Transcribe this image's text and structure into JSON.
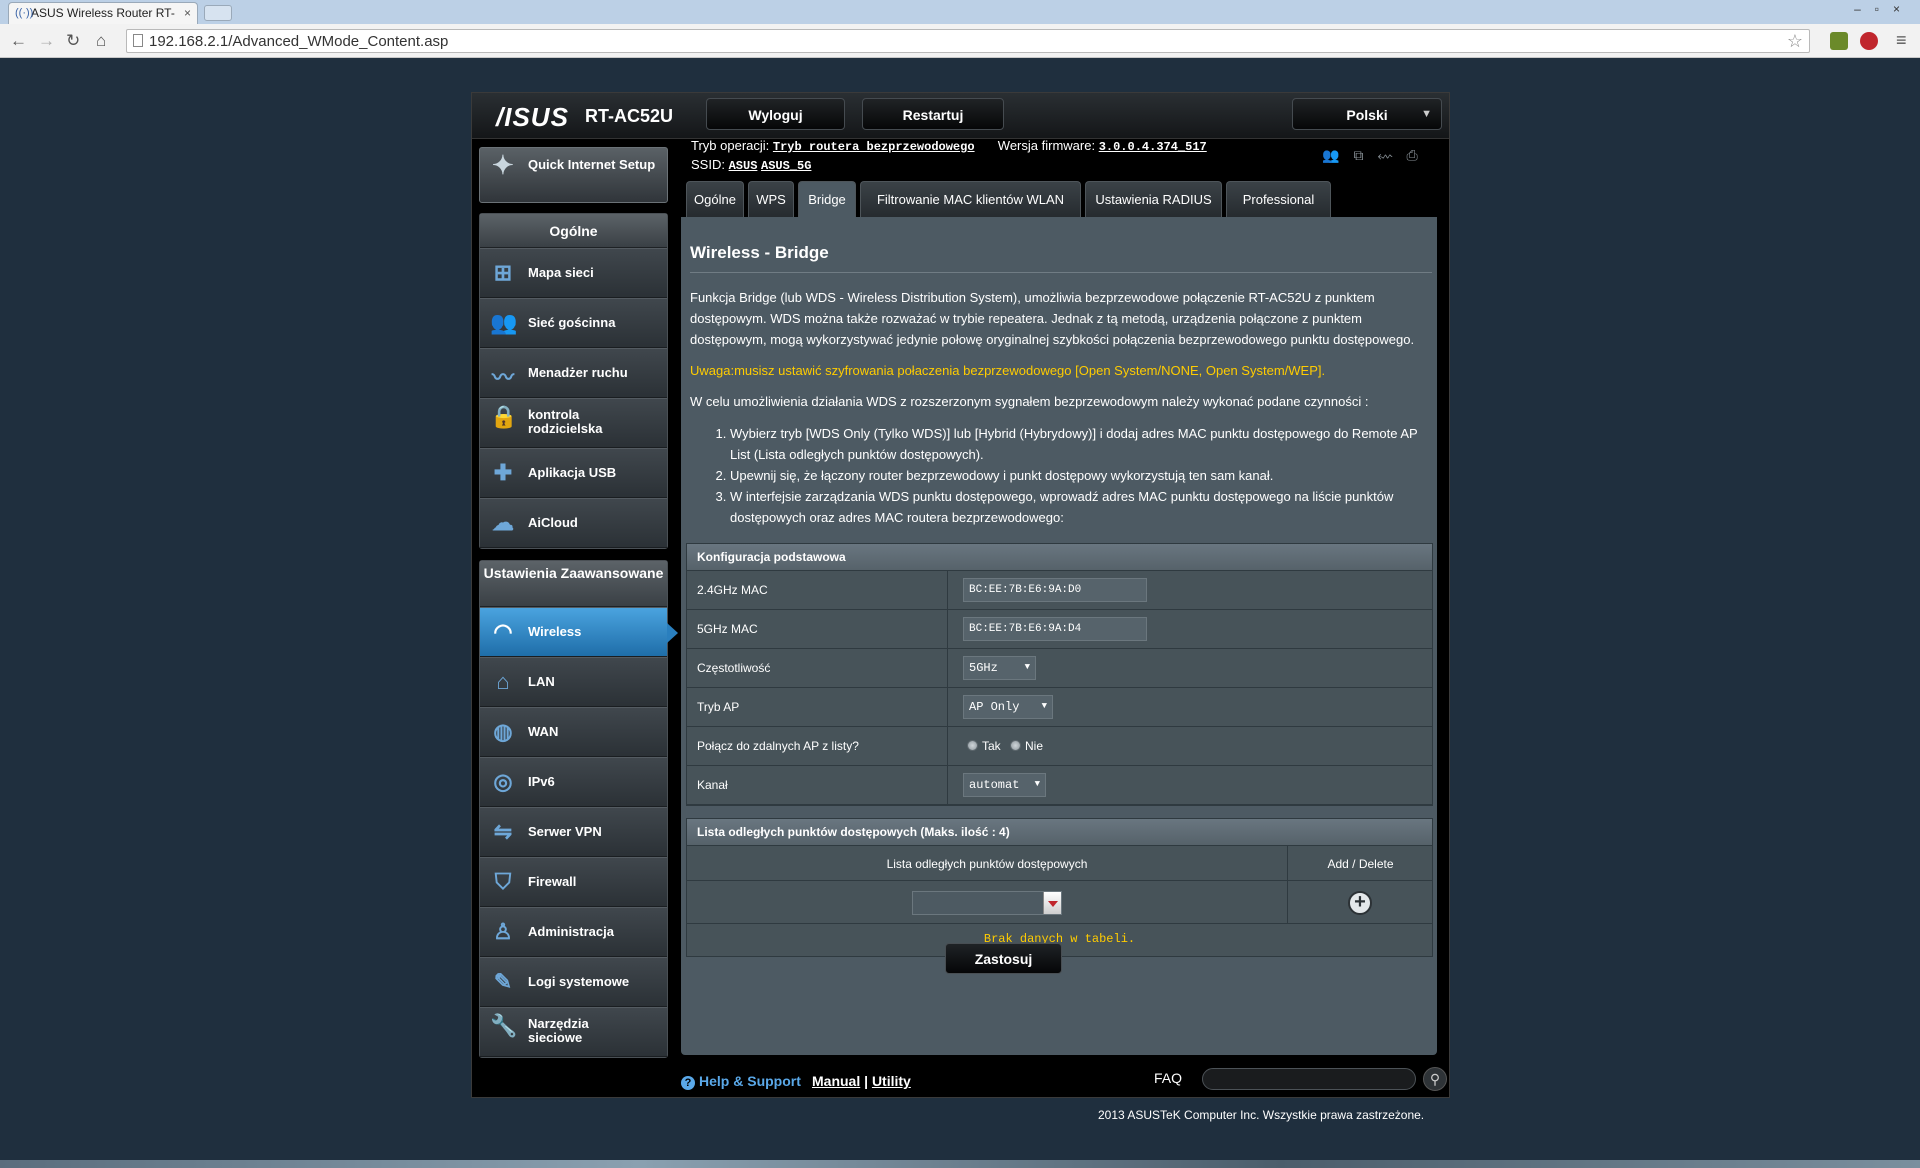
{
  "browser": {
    "tab_title": "ASUS Wireless Router RT-",
    "tab_close": "×",
    "url": "192.168.2.1/Advanced_WMode_Content.asp",
    "window_buttons": "–▫×"
  },
  "header": {
    "logo": "/ISUS",
    "model": "RT-AC52U",
    "logout_label": "Wyloguj",
    "restart_label": "Restartuj",
    "language": "Polski",
    "operation_mode_label": "Tryb operacji:",
    "operation_mode_value": "Tryb routera bezprzewodowego",
    "firmware_label": "Wersja firmware:",
    "firmware_value": "3.0.0.4.374_517",
    "ssid_label": "SSID:",
    "ssid_1": "ASUS",
    "ssid_2": "ASUS_5G"
  },
  "sidebar": {
    "qis_label": "Quick Internet Setup",
    "general_heading": "Ogólne",
    "general_items": [
      {
        "label": "Mapa sieci",
        "icon": "network-map-icon"
      },
      {
        "label": "Sieć gościnna",
        "icon": "guest-network-icon"
      },
      {
        "label": "Menadżer ruchu",
        "icon": "traffic-manager-icon"
      },
      {
        "label": "kontrola rodzicielska",
        "icon": "lock-icon"
      },
      {
        "label": "Aplikacja USB",
        "icon": "puzzle-icon"
      },
      {
        "label": "AiCloud",
        "icon": "cloud-icon"
      }
    ],
    "advanced_heading": "Ustawienia Zaawansowane",
    "advanced_items": [
      {
        "label": "Wireless",
        "icon": "wifi-icon",
        "active": true
      },
      {
        "label": "LAN",
        "icon": "home-icon"
      },
      {
        "label": "WAN",
        "icon": "globe-icon"
      },
      {
        "label": "IPv6",
        "icon": "ipv6-icon"
      },
      {
        "label": "Serwer VPN",
        "icon": "vpn-icon"
      },
      {
        "label": "Firewall",
        "icon": "shield-icon"
      },
      {
        "label": "Administracja",
        "icon": "admin-user-icon"
      },
      {
        "label": "Logi systemowe",
        "icon": "log-edit-icon"
      },
      {
        "label": "Narzędzia sieciowe",
        "icon": "wrench-icon"
      }
    ]
  },
  "tabs": [
    "Ogólne",
    "WPS",
    "Bridge",
    "Filtrowanie MAC klientów WLAN",
    "Ustawienia RADIUS",
    "Professional"
  ],
  "active_tab": "Bridge",
  "content": {
    "title": "Wireless - Bridge",
    "desc": "Funkcja Bridge (lub WDS - Wireless Distribution System), umożliwia bezprzewodowe połączenie RT-AC52U z punktem dostępowym. WDS można także rozważać w trybie repeatera. Jednak z tą metodą, urządzenia połączone z punktem dostępowym, mogą wykorzystywać jedynie połowę oryginalnej szybkości połączenia bezprzewodowego punktu dostępowego.",
    "warning": "Uwaga:musisz ustawić szyfrowania połaczenia bezprzewodowego [Open System/NONE, Open System/WEP].",
    "intro": "W celu umożliwienia działania WDS z rozszerzonym sygnałem bezprzewodowym należy wykonać podane czynności :",
    "steps": [
      "Wybierz tryb [WDS Only (Tylko WDS)] lub [Hybrid (Hybrydowy)] i dodaj adres MAC punktu dostępowego do Remote AP List (Lista odległych punktów dostępowych).",
      "Upewnij się, że łączony router bezprzewodowy i punkt dostępowy wykorzystują ten sam kanał.",
      "W interfejsie zarządzania WDS punktu dostępowego, wprowadź adres MAC punktu dostępowego na liście punktów dostępowych oraz adres MAC routera bezprzewodowego:"
    ]
  },
  "basic_config": {
    "heading": "Konfiguracja podstawowa",
    "mac24_label": "2.4GHz MAC",
    "mac24_value": "BC:EE:7B:E6:9A:D0",
    "mac5_label": "5GHz MAC",
    "mac5_value": "BC:EE:7B:E6:9A:D4",
    "freq_label": "Częstotliwość",
    "freq_value": "5GHz",
    "apmode_label": "Tryb AP",
    "apmode_value": "AP Only",
    "connect_label": "Połącz do zdalnych AP z listy?",
    "yes_label": "Tak",
    "no_label": "Nie",
    "channel_label": "Kanał",
    "channel_value": "automat"
  },
  "remote_list": {
    "heading": "Lista odległych punktów dostępowych (Maks. ilość : 4)",
    "col_list": "Lista odległych punktów dostępowych",
    "col_action": "Add / Delete",
    "add_symbol": "+",
    "empty": "Brak danych w tabeli."
  },
  "apply_label": "Zastosuj",
  "footer": {
    "help": "Help & Support",
    "manual": "Manual",
    "divider": "|",
    "utility": "Utility",
    "faq": "FAQ",
    "copyright": "2013 ASUSTeK Computer Inc. Wszystkie prawa zastrzeżone."
  }
}
